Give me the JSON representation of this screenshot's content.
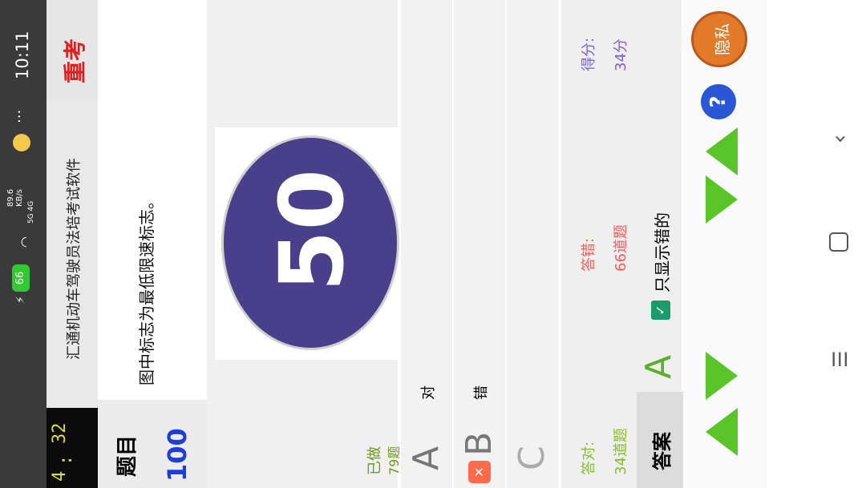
{
  "status": {
    "time": "10:11",
    "dots": "···",
    "net_speed": "89.6\nKB/s",
    "net_type": "5G 4G",
    "battery": "66"
  },
  "app": {
    "timer": "4:32",
    "timer_parts": [
      "4",
      ":",
      "32"
    ],
    "title": "汇通机动车驾驶员法培考试软件",
    "restart_label": "重考"
  },
  "question": {
    "label": "题目",
    "number": "100",
    "text": "图中标志为最低限速标志。",
    "sign_value": "50",
    "done_label": "已做",
    "done_count": "79题"
  },
  "options": [
    {
      "letter": "A",
      "text": "对"
    },
    {
      "letter": "B",
      "text": "错"
    },
    {
      "letter": "C",
      "text": ""
    }
  ],
  "score": {
    "correct_label": "答对:",
    "correct_value": "34道题",
    "wrong_label": "答错:",
    "wrong_value": "66道题",
    "score_label": "得分:",
    "score_value": "34分",
    "answer_button": "答案",
    "answer_letter": "A",
    "only_wrong_label": "只显示错的",
    "only_wrong_checked": true
  },
  "controls": {
    "hide_label": "隐私",
    "help_icon": "question-icon"
  },
  "colors": {
    "status_bg": "#3a3a3a",
    "timer_bg": "#0b0b0b",
    "timer_fg": "#dede2a",
    "restart_fg": "#e02020",
    "sign_fill": "#4a3f8a",
    "arrow_green": "#5ac528",
    "done_fg": "#6b9b1a",
    "correct_fg": "#8bbd2a",
    "wrong_fg": "#ff5a5a",
    "score_fg": "#7a62e0",
    "qnum_fg": "#1e3ed9"
  }
}
